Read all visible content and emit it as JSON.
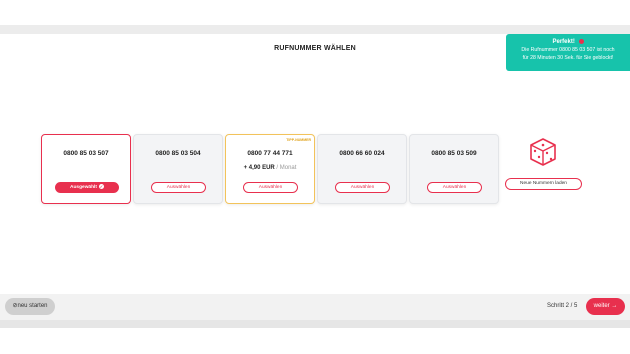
{
  "page": {
    "title": "RUFNUMMER WÄHLEN"
  },
  "toast": {
    "title": "Perfekt",
    "line1": "Die Rufnummer 0800 85 03 507 ist noch",
    "line2": "für 28 Minuten 30 Sek. für Sie geblockt!"
  },
  "cards": [
    {
      "number": "0800 85 03 507",
      "button": "Ausgewählt",
      "selected": true
    },
    {
      "number": "0800 85 03 504",
      "button": "Auswählen"
    },
    {
      "number": "0800 77 44 771",
      "badge": "TIPP-NUMMER",
      "price": "+ 4,90 EUR",
      "price_unit": "/ Monat",
      "button": "Auswählen"
    },
    {
      "number": "0800 66 60 024",
      "button": "Auswählen"
    },
    {
      "number": "0800 85 03 509",
      "button": "Auswählen"
    }
  ],
  "reload": {
    "label": "Neue Nummern laden",
    "icon": "dice-icon"
  },
  "footer": {
    "restart_label": "neu starten",
    "restart_icon": "⊘",
    "step_label": "Schritt 2 / 5",
    "next_label": "weiter",
    "next_icon": "→"
  },
  "colors": {
    "accent": "#e8304e",
    "toast": "#17c3ab",
    "tip": "#f2c35b"
  }
}
